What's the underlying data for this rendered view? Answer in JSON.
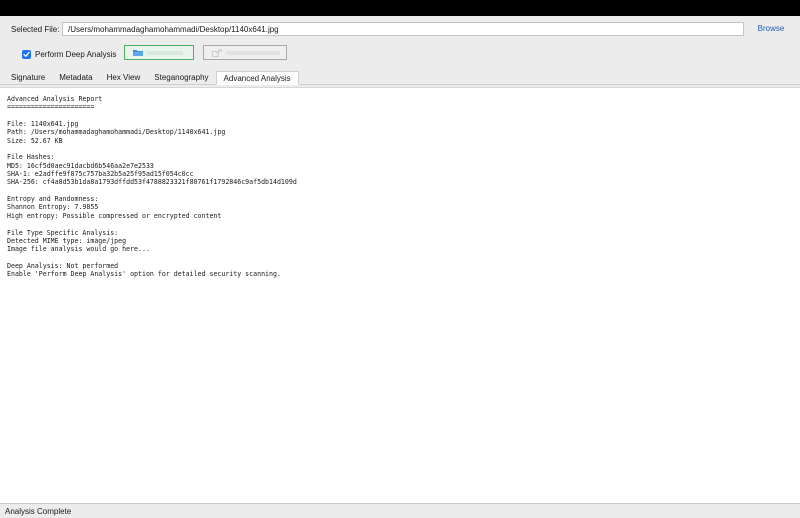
{
  "file_selector": {
    "label": "Selected File:",
    "path_value": "/Users/mohammadaghamohammadi/Desktop/1140x641.jpg",
    "browse_label": "Browse"
  },
  "options": {
    "deep_analysis_label": "Perform Deep Analysis",
    "deep_analysis_checked": true
  },
  "tabs": [
    {
      "label": "Signature"
    },
    {
      "label": "Metadata"
    },
    {
      "label": "Hex View"
    },
    {
      "label": "Steganography"
    },
    {
      "label": "Advanced Analysis"
    }
  ],
  "active_tab": "Advanced Analysis",
  "report": {
    "lines": [
      "Advanced Analysis Report",
      "======================",
      "",
      "File: 1140x641.jpg",
      "Path: /Users/mohammadaghamohammadi/Desktop/1140x641.jpg",
      "Size: 52.67 KB",
      "",
      "File Hashes:",
      "MD5: 16cf5d0aec91dacbd6b546aa2e7e2533",
      "SHA-1: e2adffe9f875c757ba32b5a25f95ad15f054c0cc",
      "SHA-256: cf4a8d53b1da8a1793dffdd53f4788823321f80761f1792846c9af5db14d109d",
      "",
      "Entropy and Randomness:",
      "Shannon Entropy: 7.9855",
      "High entropy: Possible compressed or encrypted content",
      "",
      "File Type Specific Analysis:",
      "Detected MIME type: image/jpeg",
      "Image file analysis would go here...",
      "",
      "Deep Analysis: Not performed",
      "Enable 'Perform Deep Analysis' option for detailed security scanning."
    ]
  },
  "status": {
    "text": "Analysis Complete"
  },
  "icons": {
    "analyze_button_icon": "folder-icon",
    "export_button_icon": "export-icon",
    "checkbox_icon": "checkmark-icon"
  },
  "colors": {
    "accent": "#1d74f5",
    "link": "#1a5fb4",
    "analyze_border": "#4cae63"
  }
}
